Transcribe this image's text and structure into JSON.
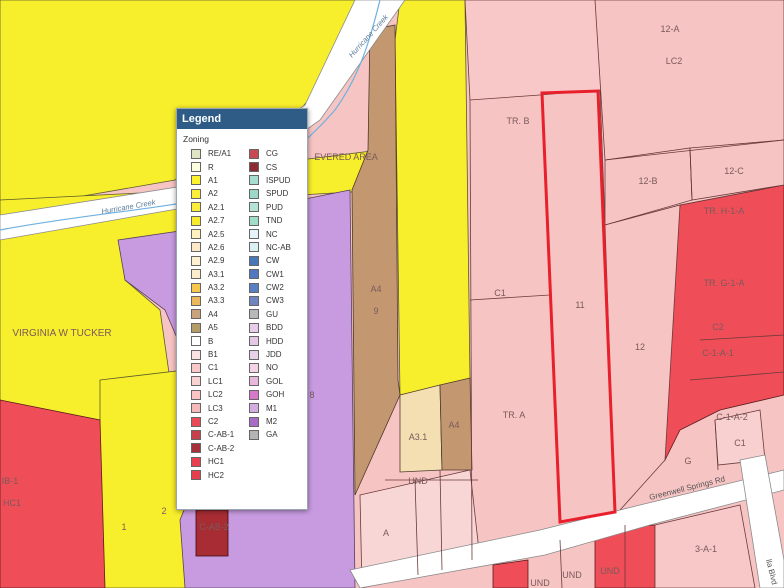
{
  "map": {
    "parcel_labels": [
      "12-A",
      "LC2",
      "TR. B",
      "12-B",
      "12-C",
      "TR. H-1-A",
      "TR. G-1-A",
      "C2",
      "C-1-A-1",
      "C-1-A-2",
      "C1",
      "G",
      "11",
      "12",
      "C1",
      "TR. A",
      "A4",
      "9",
      "A3.1",
      "A4",
      "UND",
      "A",
      "VIRGINIA W TUCKER",
      "8",
      "1",
      "2",
      "IB-1",
      "HC1",
      "3-A-1",
      "UND",
      "UND",
      "UND",
      "C-AB-2",
      "EVERED AREA"
    ],
    "streets": [
      "Hurricane Creek",
      "Hurricane Creek",
      "Greenwell Springs Rd",
      "lla Blvd"
    ]
  },
  "legend": {
    "title": "Legend",
    "subtitle": "Zoning",
    "left_items": [
      {
        "code": "RE/A1",
        "color": "#dfe5c4"
      },
      {
        "code": "R",
        "color": "#fdfde0"
      },
      {
        "code": "A1",
        "color": "#fdf22e"
      },
      {
        "code": "A2",
        "color": "#fbee3a"
      },
      {
        "code": "A2.1",
        "color": "#f9ec3c"
      },
      {
        "code": "A2.7",
        "color": "#f8ea2c"
      },
      {
        "code": "A2.5",
        "color": "#fff2bf"
      },
      {
        "code": "A2.6",
        "color": "#fde8c8"
      },
      {
        "code": "A2.9",
        "color": "#fdf2cf"
      },
      {
        "code": "A3.1",
        "color": "#fbeccb"
      },
      {
        "code": "A3.2",
        "color": "#f7c64e"
      },
      {
        "code": "A3.3",
        "color": "#ecb85a"
      },
      {
        "code": "A4",
        "color": "#c9a37d"
      },
      {
        "code": "A5",
        "color": "#b59a6a"
      },
      {
        "code": "B",
        "color": "#ffffff"
      },
      {
        "code": "B1",
        "color": "#f9e4e4"
      },
      {
        "code": "C1",
        "color": "#f8c8c8"
      },
      {
        "code": "LC1",
        "color": "#f9d2d2"
      },
      {
        "code": "LC2",
        "color": "#f8c4c4"
      },
      {
        "code": "LC3",
        "color": "#f6b8b8"
      },
      {
        "code": "C2",
        "color": "#ea4a58"
      },
      {
        "code": "C-AB-1",
        "color": "#c8404c"
      },
      {
        "code": "C-AB-2",
        "color": "#a8303a"
      },
      {
        "code": "HC1",
        "color": "#e84050"
      },
      {
        "code": "HC2",
        "color": "#e63e4c"
      }
    ],
    "right_items": [
      {
        "code": "CG",
        "color": "#c84a54"
      },
      {
        "code": "CS",
        "color": "#8c2a32"
      },
      {
        "code": "ISPUD",
        "color": "#a8dcd0"
      },
      {
        "code": "SPUD",
        "color": "#9cd8c8"
      },
      {
        "code": "PUD",
        "color": "#b4e4d8"
      },
      {
        "code": "TND",
        "color": "#a0dcc8"
      },
      {
        "code": "NC",
        "color": "#e4f4f8"
      },
      {
        "code": "NC-AB",
        "color": "#dcf0f4"
      },
      {
        "code": "CW",
        "color": "#4876b8"
      },
      {
        "code": "CW1",
        "color": "#5078c0"
      },
      {
        "code": "CW2",
        "color": "#587ec4"
      },
      {
        "code": "CW3",
        "color": "#6e86c0"
      },
      {
        "code": "GU",
        "color": "#b8b8b8"
      },
      {
        "code": "BDD",
        "color": "#e8cce8"
      },
      {
        "code": "HDD",
        "color": "#e4c8e4"
      },
      {
        "code": "JDD",
        "color": "#e8d0e8"
      },
      {
        "code": "NO",
        "color": "#f4d4e4"
      },
      {
        "code": "GOL",
        "color": "#e8b8dc"
      },
      {
        "code": "GOH",
        "color": "#d878c8"
      },
      {
        "code": "M1",
        "color": "#d4aee0"
      },
      {
        "code": "M2",
        "color": "#a86cc4"
      },
      {
        "code": "GA",
        "color": "#b4b4b4"
      }
    ]
  }
}
